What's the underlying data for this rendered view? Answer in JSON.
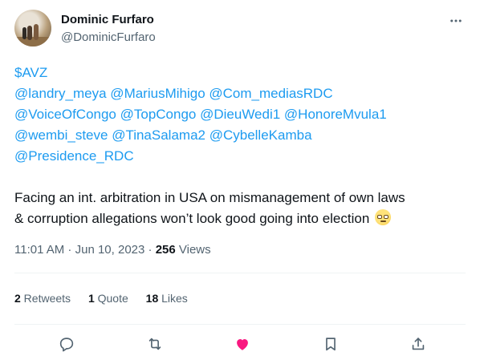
{
  "author": {
    "display_name": "Dominic Furfaro",
    "handle": "@DominicFurfaro"
  },
  "tweet": {
    "lines": [
      "$AVZ",
      "@landry_meya @MariusMihigo @Com_mediasRDC",
      "@VoiceOfCongo @TopCongo @DieuWedi1 @HonoreMvula1",
      "@wembi_steve @TinaSalama2 @CybelleKamba",
      "@Presidence_RDC"
    ],
    "paragraph_line1": "Facing an int. arbitration in USA on mismanagement of own laws",
    "paragraph_line2": "& corruption allegations won’t look good going into election",
    "emoji": "face-with-rolling-eyes"
  },
  "meta": {
    "time": "11:01 AM",
    "separator": " · ",
    "date": "Jun 10, 2023",
    "views_count": "256",
    "views_label": " Views"
  },
  "stats": {
    "retweets_count": "2",
    "retweets_label": " Retweets",
    "quotes_count": "1",
    "quotes_label": " Quote",
    "likes_count": "18",
    "likes_label": " Likes"
  },
  "colors": {
    "link": "#1d9bf0",
    "like_active": "#f91880",
    "secondary_text": "#536471",
    "primary_text": "#0f1419"
  },
  "icons": [
    "more-icon",
    "reply-icon",
    "retweet-icon",
    "like-icon",
    "bookmark-icon",
    "share-icon"
  ]
}
